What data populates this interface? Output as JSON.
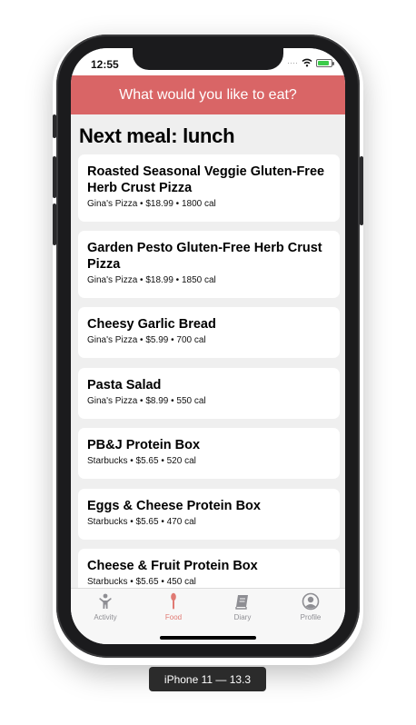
{
  "status_bar": {
    "time": "12:55"
  },
  "header": {
    "title": "What would you like to eat?",
    "color": "#d96566"
  },
  "section_title": "Next meal: lunch",
  "meals": [
    {
      "name": "Roasted Seasonal Veggie Gluten-Free Herb Crust Pizza",
      "meta": "Gina's Pizza • $18.99  • 1800 cal"
    },
    {
      "name": "Garden Pesto Gluten-Free Herb Crust Pizza",
      "meta": "Gina's Pizza • $18.99  • 1850 cal"
    },
    {
      "name": "Cheesy Garlic Bread",
      "meta": "Gina's Pizza • $5.99  • 700 cal"
    },
    {
      "name": "Pasta Salad",
      "meta": "Gina's Pizza • $8.99  • 550 cal"
    },
    {
      "name": "PB&J Protein Box",
      "meta": "Starbucks • $5.65  • 520 cal"
    },
    {
      "name": "Eggs & Cheese Protein Box",
      "meta": "Starbucks • $5.65  • 470 cal"
    },
    {
      "name": "Cheese & Fruit Protein Box",
      "meta": "Starbucks • $5.65  • 450 cal"
    }
  ],
  "tabs": [
    {
      "label": "Activity",
      "icon": "activity-icon"
    },
    {
      "label": "Food",
      "icon": "food-icon",
      "active": true
    },
    {
      "label": "Diary",
      "icon": "diary-icon"
    },
    {
      "label": "Profile",
      "icon": "profile-icon"
    }
  ],
  "device_label": "iPhone 11 — 13.3",
  "accent_color": "#e07a73"
}
